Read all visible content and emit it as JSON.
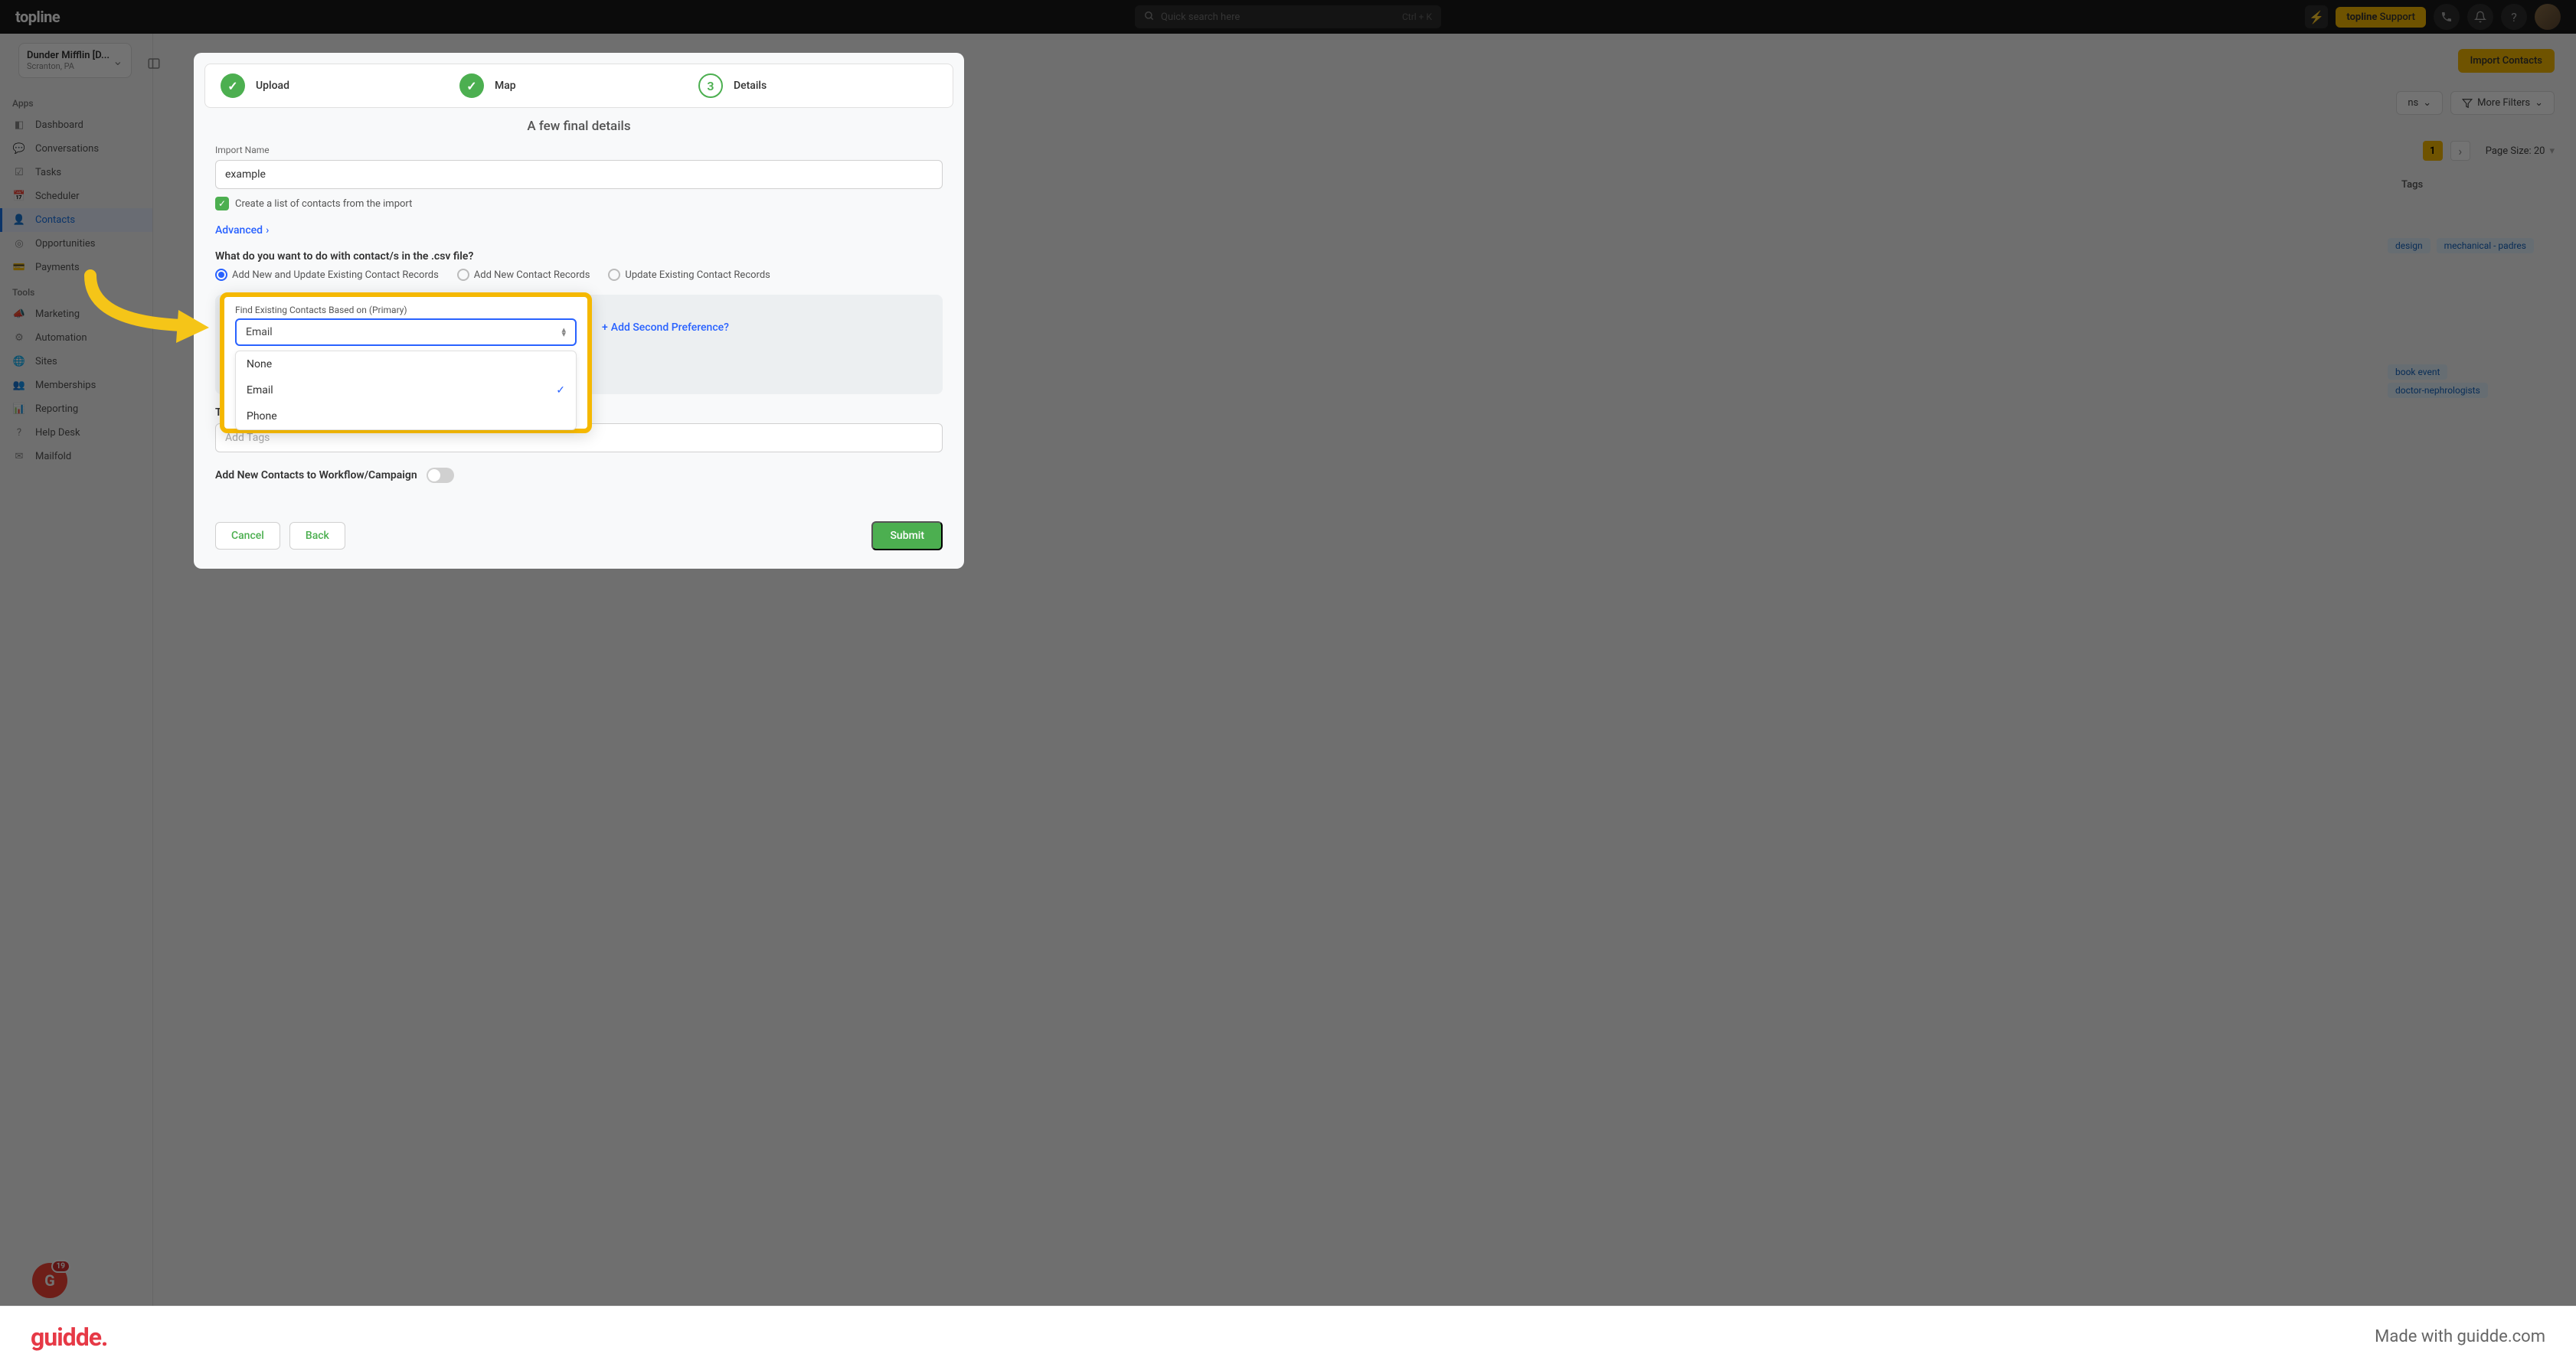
{
  "topbar": {
    "logo": "topline",
    "search_placeholder": "Quick search here",
    "search_kbd": "Ctrl + K",
    "support_prefix": "topline",
    "support_suffix": " Support"
  },
  "org": {
    "name": "Dunder Mifflin [D...",
    "location": "Scranton, PA"
  },
  "sidebar": {
    "apps_header": "Apps",
    "tools_header": "Tools",
    "apps": [
      {
        "label": "Dashboard",
        "icon": "◧"
      },
      {
        "label": "Conversations",
        "icon": "💬"
      },
      {
        "label": "Tasks",
        "icon": "☑"
      },
      {
        "label": "Scheduler",
        "icon": "📅"
      },
      {
        "label": "Contacts",
        "icon": "👤",
        "active": true
      },
      {
        "label": "Opportunities",
        "icon": "◎"
      },
      {
        "label": "Payments",
        "icon": "💳"
      }
    ],
    "tools": [
      {
        "label": "Marketing",
        "icon": "📣"
      },
      {
        "label": "Automation",
        "icon": "⚙"
      },
      {
        "label": "Sites",
        "icon": "🌐"
      },
      {
        "label": "Memberships",
        "icon": "👥"
      },
      {
        "label": "Reporting",
        "icon": "📊"
      },
      {
        "label": "Help Desk",
        "icon": "?"
      },
      {
        "label": "Mailfold",
        "icon": "✉"
      }
    ],
    "badge_count": "19"
  },
  "content": {
    "import_btn": "Import Contacts",
    "filters_ns": "ns",
    "more_filters": "More Filters",
    "page_num": "1",
    "page_size_lbl": "Page Size: 20",
    "tags_header": "Tags",
    "tags_row1": [
      "design",
      "mechanical - padres"
    ],
    "tags_row2": [
      "book event",
      "doctor-nephrologists"
    ]
  },
  "modal": {
    "steps": [
      {
        "label": "Upload",
        "state": "done"
      },
      {
        "label": "Map",
        "state": "done"
      },
      {
        "label": "Details",
        "state": "cur",
        "num": "3"
      }
    ],
    "title": "A few final details",
    "import_name_lbl": "Import Name",
    "import_name_val": "example",
    "create_list_lbl": "Create a list of contacts from the import",
    "advanced": "Advanced",
    "question": "What do you want to do with contact/s in the .csv file?",
    "radios": [
      {
        "label": "Add New and Update Existing Contact Records",
        "sel": true
      },
      {
        "label": "Add New Contact Records",
        "sel": false
      },
      {
        "label": "Update Existing Contact Records",
        "sel": false
      }
    ],
    "tags_label": "Tags",
    "tags_placeholder": "Add Tags",
    "workflow_label": "Add New Contacts to Workflow/Campaign",
    "cancel": "Cancel",
    "back": "Back",
    "submit": "Submit"
  },
  "highlight": {
    "label": "Find Existing Contacts Based on (Primary)",
    "selected": "Email",
    "options": [
      {
        "label": "None",
        "sel": false
      },
      {
        "label": "Email",
        "sel": true
      },
      {
        "label": "Phone",
        "sel": false
      }
    ],
    "add_second": "Add Second Preference?"
  },
  "footer": {
    "logo": "guidde.",
    "made_with": "Made with guidde.com"
  }
}
